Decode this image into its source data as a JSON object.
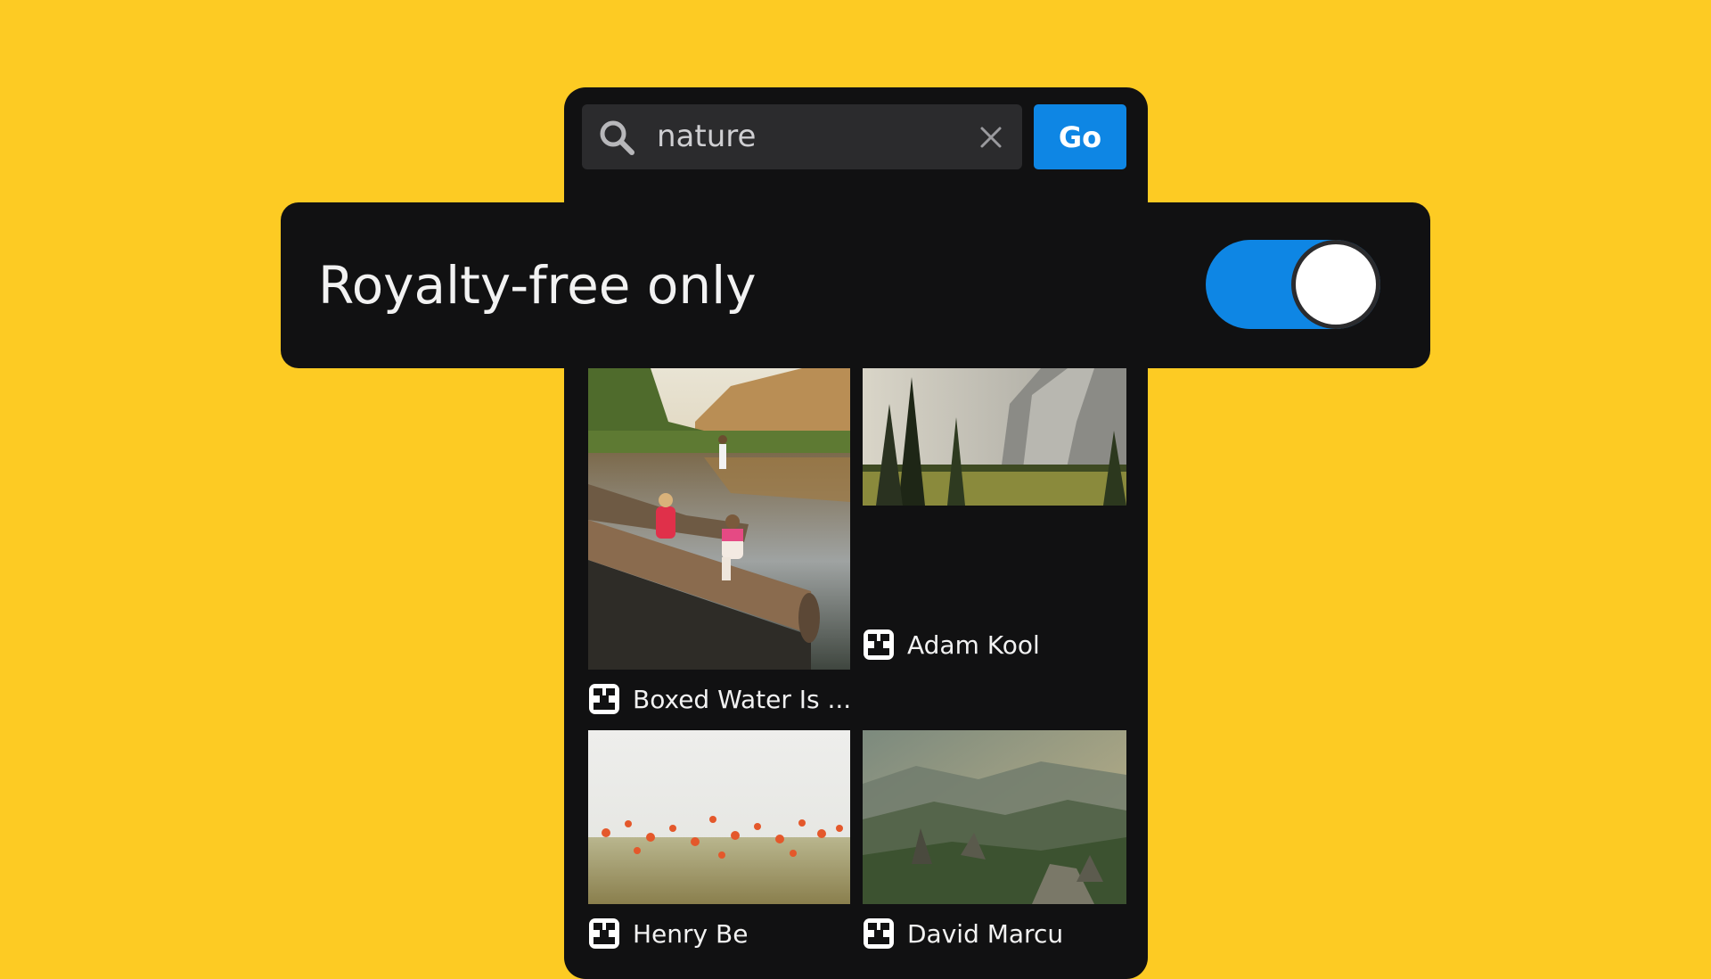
{
  "search": {
    "value": "nature",
    "go_label": "Go",
    "icon": "search-icon",
    "clear_icon": "close-icon"
  },
  "filter": {
    "label": "Royalty-free only",
    "enabled": true
  },
  "results": [
    {
      "author": "Boxed Water Is ...",
      "scene": "lake-with-logs-and-people"
    },
    {
      "author": "Adam Kool",
      "scene": "forest-valley-with-cliff"
    },
    {
      "author": "Henry Be",
      "scene": "poppy-field"
    },
    {
      "author": "David Marcu",
      "scene": "mountain-valley-sunlight"
    }
  ],
  "colors": {
    "background": "#FDCB23",
    "panel": "#111112",
    "accent": "#0E86E4",
    "search_field": "#2B2B2D"
  }
}
